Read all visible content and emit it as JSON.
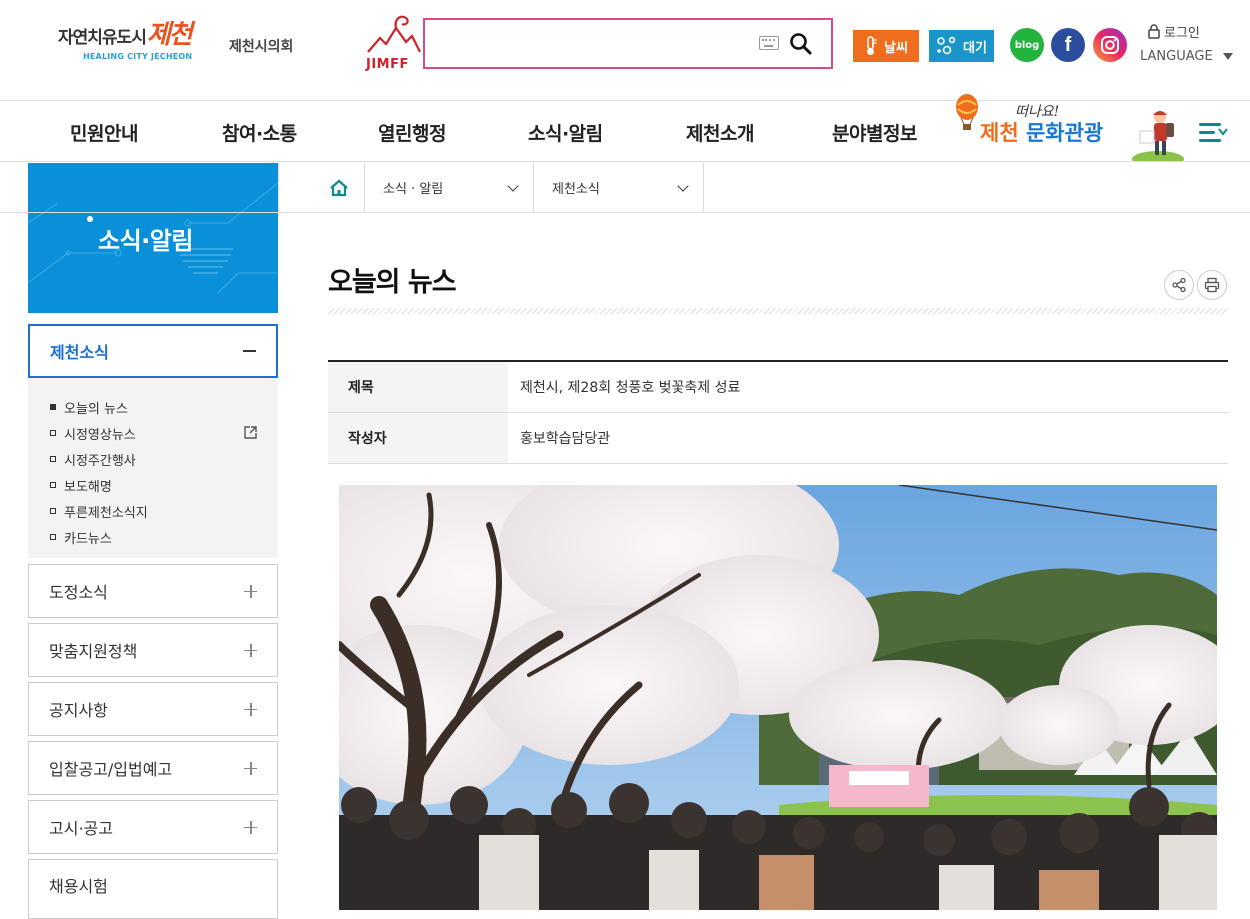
{
  "header": {
    "logo_kor": "자연치유도시",
    "logo_city": "제천",
    "logo_eng": "HEALING CITY JECHEON",
    "council": "제천시의회",
    "festival_logo": "JIMFF",
    "search": {
      "placeholder": "",
      "value": ""
    },
    "weather_label": "날씨",
    "air_label": "대기",
    "blog_label": "blog",
    "facebook_label": "f",
    "login_label": "로그인",
    "language_label": "LANGUAGE"
  },
  "gnb": {
    "items": [
      "민원안내",
      "참여·소통",
      "열린행정",
      "소식·알림",
      "제천소개",
      "분야별정보"
    ],
    "tour_banner_small": "떠나요!",
    "tour_banner_city": "제천",
    "tour_banner_text": "문화관광"
  },
  "side_banner_title": "소식·알림",
  "breadcrumb": {
    "level1": "소식 · 알림",
    "level2": "제천소식"
  },
  "lnb": {
    "open_label": "제천소식",
    "sub_items": [
      "오늘의 뉴스",
      "시정영상뉴스",
      "시정주간행사",
      "보도해명",
      "푸른제천소식지",
      "카드뉴스"
    ],
    "items": [
      "도정소식",
      "맞춤지원정책",
      "공지사항",
      "입찰공고/입법예고",
      "고시·공고",
      "채용시험"
    ]
  },
  "content": {
    "page_title": "오늘의 뉴스",
    "rows": [
      {
        "label": "제목",
        "value": "제천시, 제28회 청풍호 벚꽃축제 성료"
      },
      {
        "label": "작성자",
        "value": "홍보학습담당관"
      }
    ]
  },
  "colors": {
    "accent_blue": "#0990d8",
    "active_border": "#1a6fd1",
    "search_border": "#d9488f",
    "weather_bg": "#f06d1e",
    "air_bg": "#1a95c9"
  }
}
